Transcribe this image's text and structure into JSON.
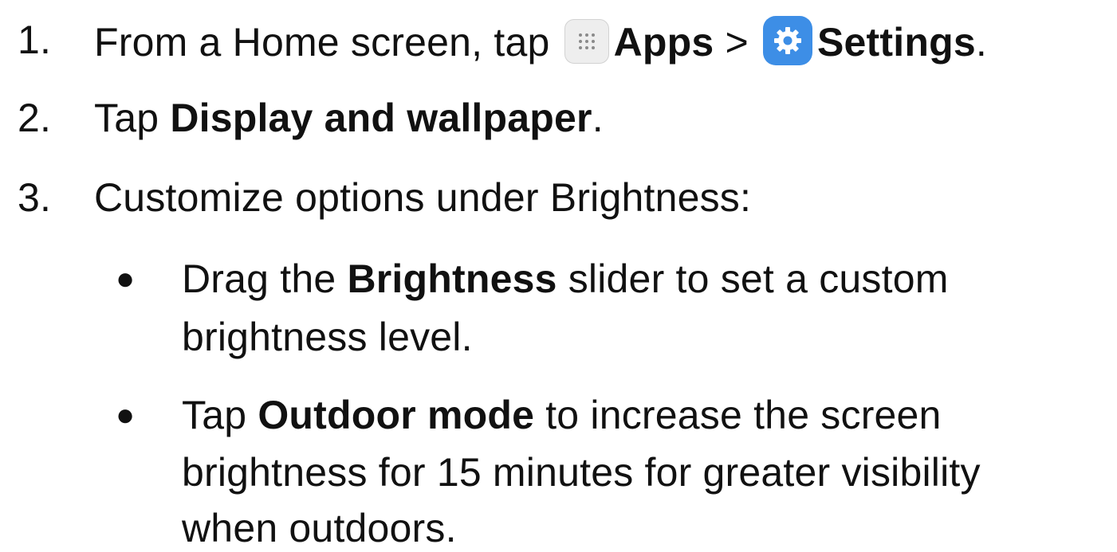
{
  "steps": [
    {
      "number": "1.",
      "prefix": "From a Home screen, tap",
      "apps_icon": "apps-grid-icon",
      "apps_label": "Apps",
      "separator": ">",
      "settings_icon": "settings-gear-icon",
      "settings_label": "Settings",
      "suffix": "."
    },
    {
      "number": "2.",
      "prefix": "Tap",
      "bold": "Display and wallpaper",
      "suffix": "."
    },
    {
      "number": "3.",
      "text": "Customize options under Brightness:"
    }
  ],
  "bullets": [
    {
      "symbol": "●",
      "line1_prefix": "Drag the",
      "line1_bold": "Brightness",
      "line1_suffix": "slider to set a custom",
      "line2": "brightness level."
    },
    {
      "symbol": "●",
      "line1_prefix": "Tap",
      "line1_bold": "Outdoor mode",
      "line1_suffix": "to increase the screen",
      "line2": "brightness for 15 minutes for greater visibility",
      "line3": "when outdoors."
    }
  ],
  "colors": {
    "text": "#111111",
    "settings_icon_bg": "#3d8ee6",
    "apps_icon_bg": "#eeeeee"
  }
}
